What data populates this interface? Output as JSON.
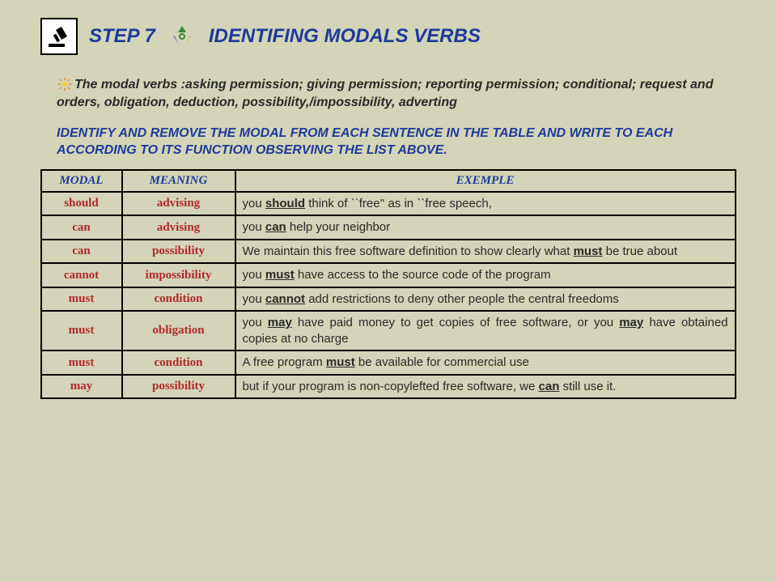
{
  "header": {
    "step_label": "STEP 7",
    "title": "IDENTIFING MODALS VERBS"
  },
  "intro": "The modal verbs :asking permission; giving permission; reporting permission; conditional; request and orders, obligation, deduction, possibility,/impossibility, adverting",
  "instruction": "IDENTIFY AND REMOVE THE MODAL FROM EACH SENTENCE IN THE TABLE AND WRITE TO EACH ACCORDING TO ITS FUNCTION OBSERVING THE LIST ABOVE.",
  "table": {
    "headers": {
      "c1": "MODAL",
      "c2": "MEANING",
      "c3": "EXEMPLE"
    },
    "rows": [
      {
        "modal": "should",
        "meaning": "advising",
        "pre": "you ",
        "kw": "should",
        "post": " think of ``free'' as in ``free speech,"
      },
      {
        "modal": "can",
        "meaning": "advising",
        "pre": "you ",
        "kw": "can",
        "post": " help your neighbor"
      },
      {
        "modal": "can",
        "meaning": "possibility",
        "pre": "We maintain this free software definition to show clearly what ",
        "kw": "must",
        "post": " be true about"
      },
      {
        "modal": "cannot",
        "meaning": "impossibility",
        "pre": "you ",
        "kw": "must",
        "post": " have access to the source code of the program"
      },
      {
        "modal": "must",
        "meaning": "condition",
        "pre": "you ",
        "kw": "cannot",
        "post": " add restrictions to deny other people the central freedoms"
      },
      {
        "modal": "must",
        "meaning": "obligation",
        "pre": "you ",
        "kw": "may",
        "mid": " have paid money to get copies of free software, or you ",
        "kw2": "may",
        "post": " have obtained copies at no charge"
      },
      {
        "modal": "must",
        "meaning": "condition",
        "pre": "A free program ",
        "kw": "must",
        "post": " be available for commercial use"
      },
      {
        "modal": "may",
        "meaning": "possibility",
        "pre": "but if your program is non-copylefted free software, we ",
        "kw": "can",
        "post": " still use it."
      }
    ]
  }
}
